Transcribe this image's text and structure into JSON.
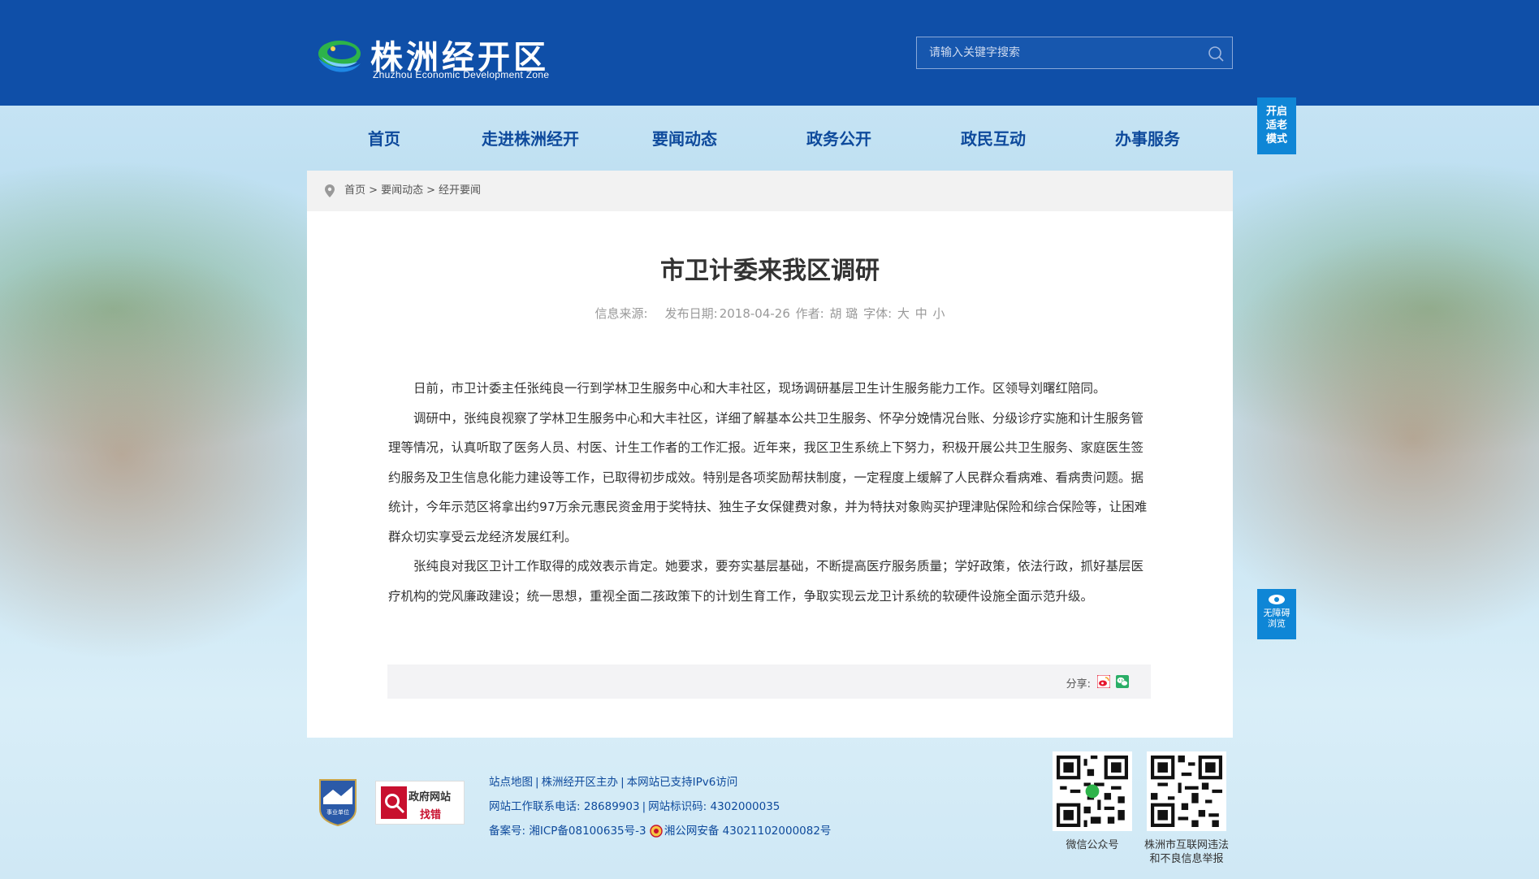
{
  "header": {
    "logo_cn": "株洲经开区",
    "logo_en": "Zhuzhou Economic Development Zone",
    "search_placeholder": "请输入关键字搜索"
  },
  "nav": [
    {
      "label": "首页"
    },
    {
      "label": "走进株洲经开"
    },
    {
      "label": "要闻动态"
    },
    {
      "label": "政务公开"
    },
    {
      "label": "政民互动"
    },
    {
      "label": "办事服务"
    }
  ],
  "side": {
    "elder_mode": [
      "开启",
      "适老",
      "模式"
    ],
    "accessibility": [
      "无障碍",
      "浏览"
    ]
  },
  "breadcrumb": {
    "items": [
      "首页",
      "要闻动态",
      "经开要闻"
    ],
    "separator": ">"
  },
  "article": {
    "title": "市卫计委来我区调研",
    "source_label": "信息来源:",
    "date_label": "发布日期:",
    "date": "2018-04-26",
    "author_label": "作者:",
    "author": "胡 璐",
    "font_label": "字体:",
    "font_sizes": [
      "大",
      "中",
      "小"
    ],
    "paragraphs": [
      "日前，市卫计委主任张纯良一行到学林卫生服务中心和大丰社区，现场调研基层卫生计生服务能力工作。区领导刘曙红陪同。",
      "调研中，张纯良视察了学林卫生服务中心和大丰社区，详细了解基本公共卫生服务、怀孕分娩情况台账、分级诊疗实施和计生服务管理等情况，认真听取了医务人员、村医、计生工作者的工作汇报。近年来，我区卫生系统上下努力，积极开展公共卫生服务、家庭医生签约服务及卫生信息化能力建设等工作，已取得初步成效。特别是各项奖励帮扶制度，一定程度上缓解了人民群众看病难、看病贵问题。据统计，今年示范区将拿出约97万余元惠民资金用于奖特扶、独生子女保健费对象，并为特扶对象购买护理津贴保险和综合保险等，让困难群众切实享受云龙经济发展红利。",
      "张纯良对我区卫计工作取得的成效表示肯定。她要求，要夯实基层基础，不断提高医疗服务质量；学好政策，依法行政，抓好基层医疗机构的党风廉政建设；统一思想，重视全面二孩政策下的计划生育工作，争取实现云龙卫计系统的软硬件设施全面示范升级。"
    ],
    "share_label": "分享:"
  },
  "footer": {
    "badge1_text": "事业单位",
    "badge2_line1": "政府网站",
    "badge2_line2": "找错",
    "links": [
      "站点地图",
      "株洲经开区主办",
      "本网站已支持IPv6访问"
    ],
    "contact_label": "网站工作联系电话:",
    "contact": "28689903",
    "site_id_label": "网站标识码:",
    "site_id": "4302000035",
    "icp_label": "备案号:",
    "icp": "湘ICP备08100635号-3",
    "police": "湘公网安备 43021102000082号",
    "qr1_label": "微信公众号",
    "qr2_label_line1": "株洲市互联网违法",
    "qr2_label_line2": "和不良信息举报"
  },
  "colors": {
    "header_bg": "#0f4fa8",
    "nav_text": "#0e4a9c",
    "side_button": "#0f86d6",
    "share_weibo": "#e6162d",
    "share_wechat": "#2aae67"
  }
}
